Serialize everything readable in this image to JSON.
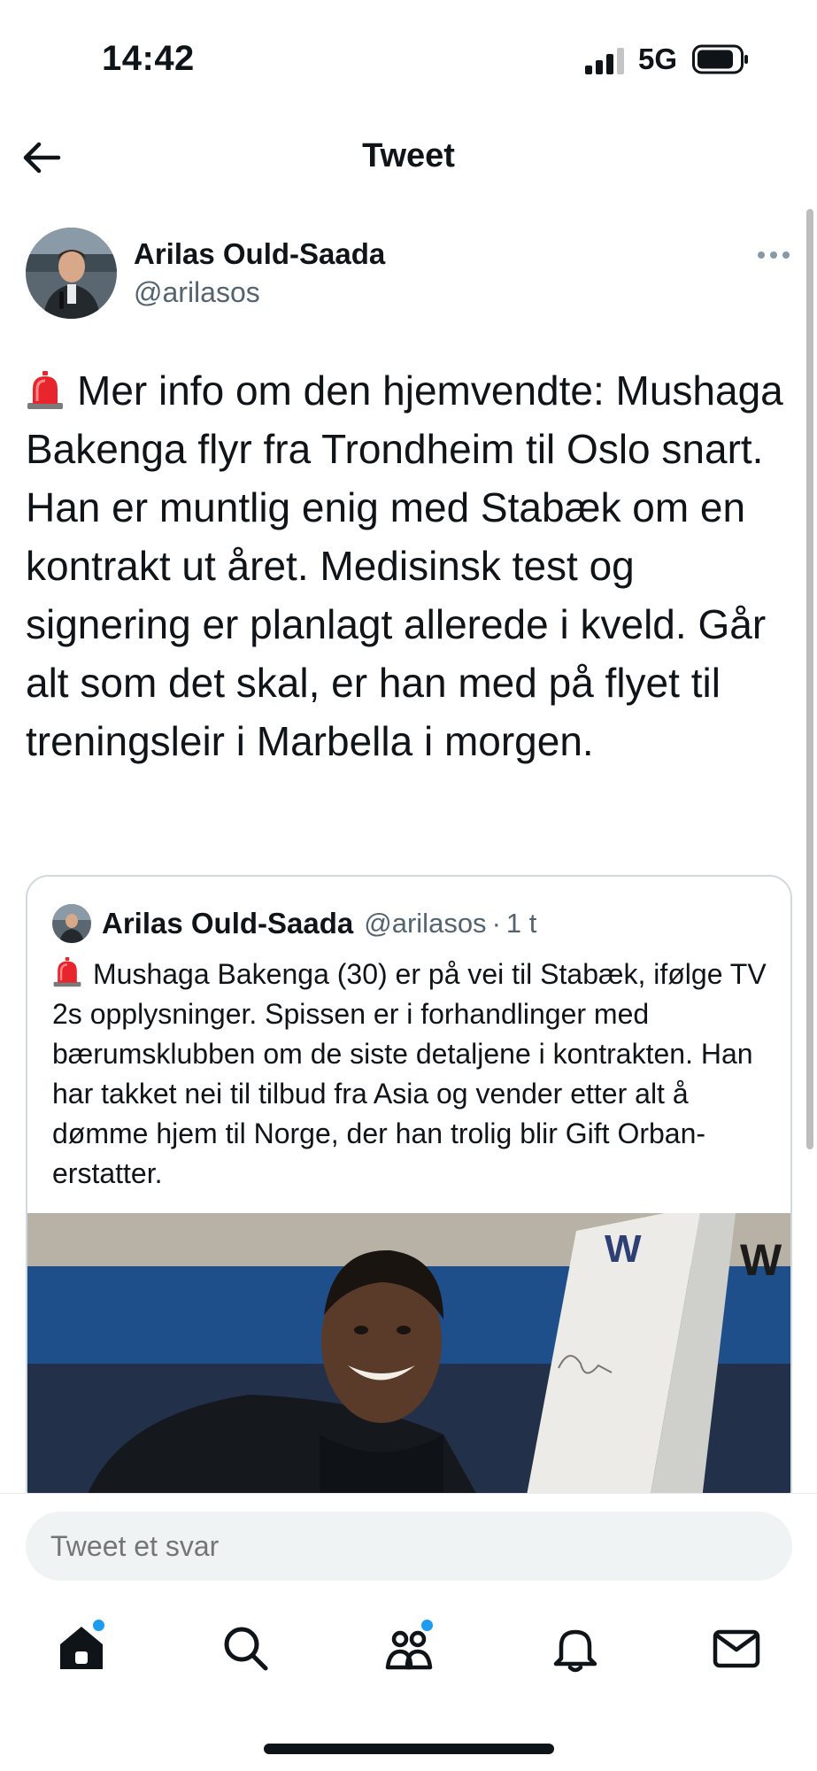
{
  "status_bar": {
    "time": "14:42",
    "network": "5G",
    "icons": [
      "signal-icon",
      "battery-icon"
    ]
  },
  "header": {
    "title": "Tweet",
    "back_icon": "arrow-left-icon"
  },
  "tweet": {
    "author_name": "Arilas Ould-Saada",
    "author_handle": "@arilasos",
    "more_icon": "more-horizontal-icon",
    "emoji_icon": "siren-emoji-icon",
    "text": "Mer info om den hjemvendte: Mushaga Bakenga flyr fra Trondheim til Oslo snart. Han er muntlig enig med Stabæk om en kontrakt ut året. Medisinsk test og signering er planlagt allerede i kveld. Går alt som det skal, er han med på flyet til treningsleir i Marbella i morgen."
  },
  "quoted_tweet": {
    "author_name": "Arilas Ould-Saada",
    "author_handle": "@arilasos",
    "separator": "·",
    "time": "1 t",
    "emoji_icon": "siren-emoji-icon",
    "text": "Mushaga Bakenga (30) er på vei til Stabæk, ifølge TV 2s opplysninger. Spissen er i forhandlinger med bærumsklubben om de siste detaljene i kontrakten. Han har takket nei til tilbud fra Asia og vender etter alt å dømme hjem til Norge, der han trolig blir Gift Orban-erstatter."
  },
  "reply": {
    "placeholder": "Tweet et svar"
  },
  "nav": {
    "items": [
      {
        "icon": "home-icon",
        "has_dot": true
      },
      {
        "icon": "search-icon",
        "has_dot": false
      },
      {
        "icon": "communities-icon",
        "has_dot": true
      },
      {
        "icon": "bell-icon",
        "has_dot": false
      },
      {
        "icon": "mail-icon",
        "has_dot": false
      }
    ]
  },
  "colors": {
    "text": "#0f1419",
    "secondary": "#536471",
    "accent": "#1d9bf0",
    "border": "#cfd9de",
    "input_bg": "#eff3f4"
  }
}
